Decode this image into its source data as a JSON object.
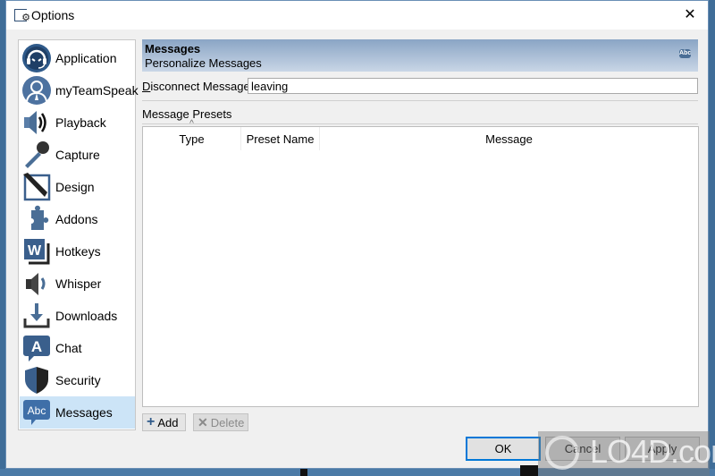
{
  "window": {
    "title": "Options",
    "app_icon": "options-gear-icon",
    "close_icon": "close-icon",
    "close_glyph": "✕"
  },
  "sidebar": {
    "items": [
      {
        "label": "Application",
        "icon": "headset-icon",
        "selected": false
      },
      {
        "label": "myTeamSpeak",
        "icon": "user-avatar-icon",
        "selected": false
      },
      {
        "label": "Playback",
        "icon": "speaker-icon",
        "selected": false
      },
      {
        "label": "Capture",
        "icon": "microphone-icon",
        "selected": false
      },
      {
        "label": "Design",
        "icon": "pencil-icon",
        "selected": false
      },
      {
        "label": "Addons",
        "icon": "puzzle-icon",
        "selected": false
      },
      {
        "label": "Hotkeys",
        "icon": "keyboard-key-icon",
        "selected": false
      },
      {
        "label": "Whisper",
        "icon": "whisper-speaker-icon",
        "selected": false
      },
      {
        "label": "Downloads",
        "icon": "download-icon",
        "selected": false
      },
      {
        "label": "Chat",
        "icon": "chat-bubble-icon",
        "selected": false
      },
      {
        "label": "Security",
        "icon": "shield-icon",
        "selected": false
      },
      {
        "label": "Messages",
        "icon": "abc-bubble-icon",
        "selected": true
      }
    ]
  },
  "header": {
    "title": "Messages",
    "subtitle": "Personalize Messages",
    "icon_text": "Abc"
  },
  "disconnect": {
    "label_first": "D",
    "label_rest": "isconnect Message:",
    "value": "leaving"
  },
  "presets": {
    "label": "Message Presets",
    "columns": [
      "Type",
      "Preset Name",
      "Message"
    ],
    "sort_indicator": "^",
    "rows": []
  },
  "actions": {
    "add_label": "Add",
    "add_glyph": "+",
    "delete_label": "Delete",
    "delete_glyph": "✕"
  },
  "dialog_buttons": {
    "ok": "OK",
    "cancel": "Cancel",
    "apply": "Apply"
  },
  "watermark": {
    "text": "LO4D.com"
  },
  "colors": {
    "accent": "#0078d7",
    "selected_bg": "#cce4f7",
    "header_top": "#8aa5c5",
    "header_bottom": "#c9d6e6",
    "icon_blue": "#2f5a8a"
  }
}
